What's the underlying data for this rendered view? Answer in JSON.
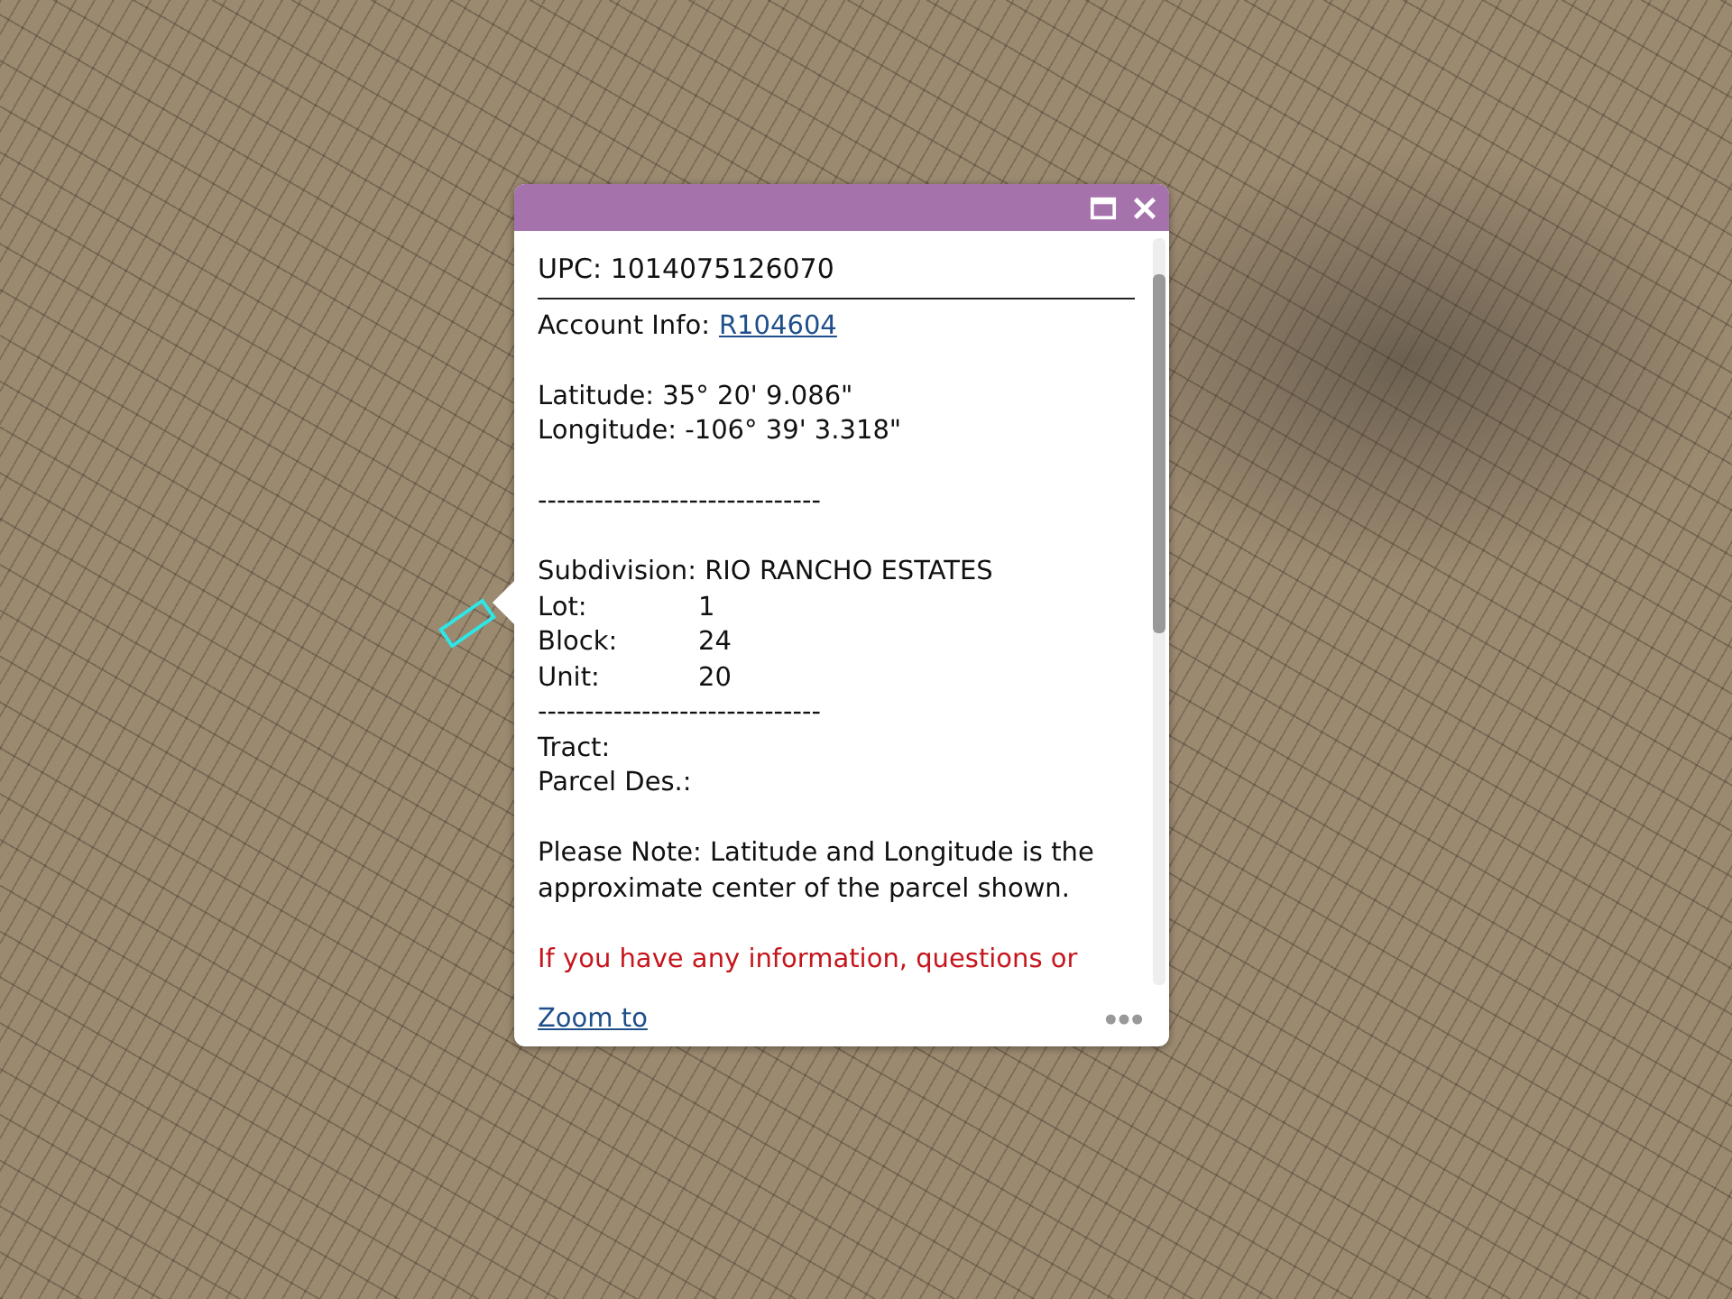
{
  "popup": {
    "heading": "UPC: 1014075126070",
    "account": {
      "label": "Account Info:",
      "link": "R104604"
    },
    "coordinates": [
      "Latitude: 35° 20' 9.086\"",
      "Longitude: -106° 39' 3.318\""
    ],
    "separator_1": "------------------------------",
    "subdivision": "Subdivision: RIO RANCHO ESTATES",
    "parcel_fields": [
      {
        "label": "Lot:",
        "value": "1"
      },
      {
        "label": "Block:",
        "value": "24"
      },
      {
        "label": "Unit:",
        "value": "20"
      }
    ],
    "separator_2": "------------------------------",
    "extra_fields": [
      "Tract:",
      "Parcel Des.:"
    ],
    "note": "Please Note: Latitude and Longitude is the approximate center of the parcel shown.",
    "warning": "If you have any information, questions or",
    "zoom_link": "Zoom to"
  }
}
